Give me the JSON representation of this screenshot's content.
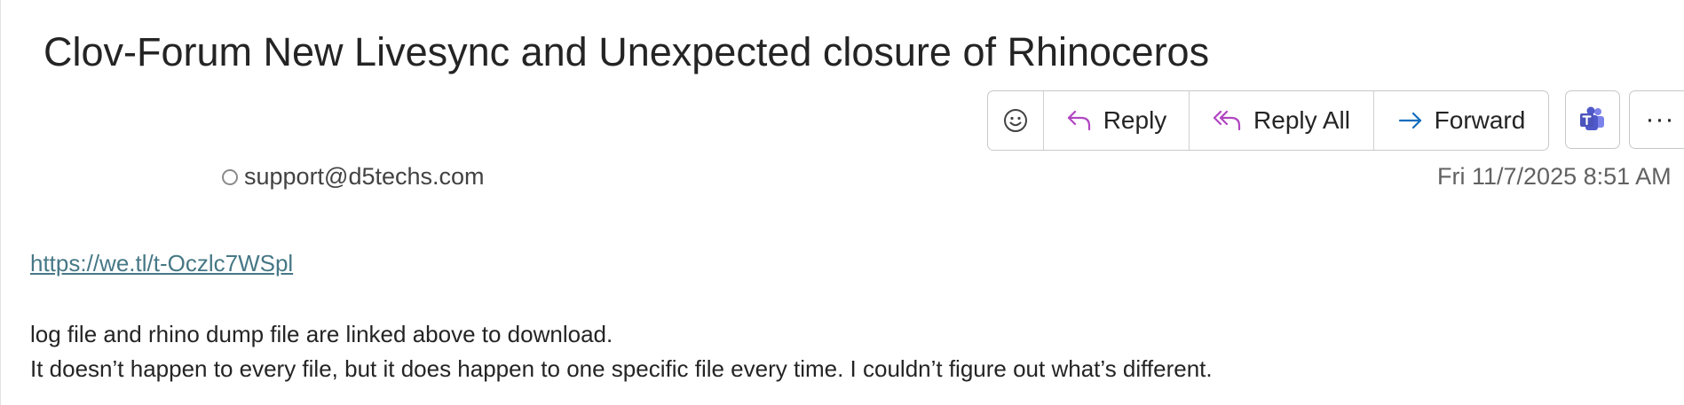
{
  "email": {
    "subject": "Clov-Forum New Livesync and Unexpected closure of Rhinoceros",
    "sender": "support@d5techs.com",
    "date": "Fri 11/7/2025 8:51 AM",
    "link": "https://we.tl/t-Oczlc7WSpl",
    "body_lines": [
      "log file and rhino dump file are linked above to download.",
      "It doesn’t happen to every file, but it does happen to one specific file every time. I couldn’t figure out what’s different."
    ]
  },
  "toolbar": {
    "emoji_icon": "smiley-icon",
    "reply_label": "Reply",
    "reply_all_label": "Reply All",
    "forward_label": "Forward",
    "teams_icon": "teams-icon",
    "more_label": "···"
  },
  "colors": {
    "reply_arrow": "#b146c2",
    "forward_arrow": "#0f6cbd",
    "teams": "#4b53bc",
    "link": "#467886"
  }
}
